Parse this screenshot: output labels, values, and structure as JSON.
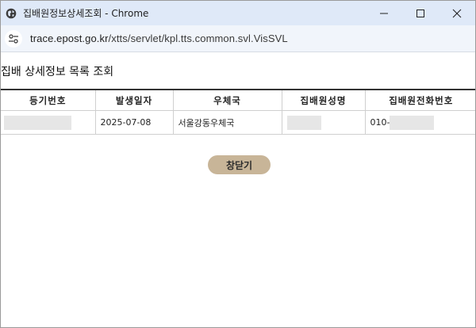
{
  "window": {
    "title": "집배원정보상세조회 - Chrome",
    "controls": {
      "minimize": "minimize-icon",
      "maximize": "maximize-icon",
      "close": "close-icon"
    }
  },
  "address_bar": {
    "host": "trace.epost.go.kr",
    "path": "/xtts/servlet/kpl.tts.common.svl.VisSVL"
  },
  "page": {
    "title": "집배 상세정보 목록 조회",
    "table": {
      "headers": [
        "등기번호",
        "발생일자",
        "우체국",
        "집배원성명",
        "집배원전화번호"
      ],
      "rows": [
        {
          "reg_no": "",
          "date": "2025-07-08",
          "office": "서울강동우체국",
          "carrier_name": "",
          "phone_prefix": "010-"
        }
      ]
    },
    "close_button": "창닫기"
  },
  "colors": {
    "titlebar_bg": "#dfe9f8",
    "addressbar_bg": "#f1f5fb",
    "button_bg": "#c8b598",
    "redacted": "#e6e6e6"
  }
}
